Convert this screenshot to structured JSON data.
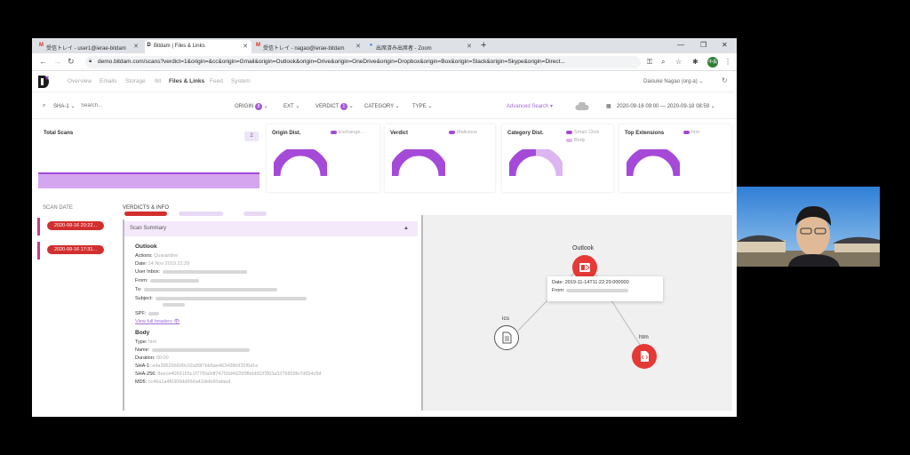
{
  "browser": {
    "tabs": [
      {
        "label": "受信トレイ - user1@ierae-bitdam",
        "icon": "gmail-icon"
      },
      {
        "label": "Bitdam | Files & Links",
        "icon": "bitdam-icon"
      },
      {
        "label": "受信トレイ - nagao@ierae-bitdam",
        "icon": "gmail-icon"
      },
      {
        "label": "出席済み出席者 - Zoom",
        "icon": "zoom-icon"
      }
    ],
    "url": "demo.bitdam.com/scans?verdict=1&origin=&cc&origin=Gmail&origin=Outlook&origin=Drive&origin=OneDrive&origin=Dropbox&origin=Box&origin=Slack&origin=Skype&origin=Direct...",
    "profile_initials": "中長"
  },
  "app": {
    "nav": [
      "Overview",
      "Emails",
      "Storage",
      "IM",
      "Files & Links",
      "Feed",
      "System"
    ],
    "active_nav": "Files & Links",
    "user": "Daisuke Nagao (org-a)"
  },
  "filters": {
    "hash_type": "SHA-1",
    "search_placeholder": "Search...",
    "origin": "ORIGIN",
    "origin_count": "8",
    "ext": "EXT",
    "verdict": "VERDICT",
    "verdict_count": "1",
    "category": "CATEGORY",
    "type": "TYPE",
    "advanced_search": "Advanced Search",
    "date_range": "2020-09-16 09:00 — 2020-09-18 08:59"
  },
  "cards": {
    "total_scans": {
      "title": "Total Scans",
      "count": "2"
    },
    "origin_dist": {
      "title": "Origin Dist.",
      "legend": [
        "Exchange..."
      ]
    },
    "verdict": {
      "title": "Verdict",
      "legend": [
        "Malicious"
      ]
    },
    "category_dist": {
      "title": "Category Dist.",
      "legend": [
        "Smart Click",
        "Body"
      ],
      "values": [
        0.5,
        0.5
      ]
    },
    "top_extensions": {
      "title": "Top Extensions",
      "legend": [
        "htm"
      ]
    }
  },
  "colors": {
    "accent": "#a54ad8",
    "light": "#dcb5f1",
    "malicious": "#e53935"
  },
  "scans": {
    "col_scan_date": "SCAN DATE",
    "col_verdicts": "VERDICTS & INFO",
    "rows": [
      "2020-09-16 20:22...",
      "2020-09-16 17:31..."
    ]
  },
  "summary": {
    "header": "Scan Summary",
    "outlook_title": "Outlook",
    "actions_label": "Actions:",
    "actions_value": "Quarantine",
    "date_label": "Date:",
    "date_value": "14 Nov 2019 22:29",
    "inbox_label": "User Inbox:",
    "from_label": "From:",
    "to_label": "To:",
    "subject_label": "Subject:",
    "spf_label": "SPF:",
    "view_headers": "View full headers",
    "body_title": "Body",
    "type_label": "Type:",
    "type_value": "htm",
    "name_label": "Name:",
    "duration_label": "Duration:",
    "duration_value": "00:00",
    "sha1_label": "SHA-1:",
    "sha1_value": "a4a396296699c02a99f7bb6ae463438b925f6d1e",
    "sha256_label": "SHA-256:",
    "sha256_value": "8eece4069165c1f77f0a9df74750d4925f3ffebb52f3f03a3376859fe7d654cfbf",
    "md5_label": "MD5:",
    "md5_value": "cc46a1a4f0309dd964a42defe60afaed"
  },
  "graph": {
    "outlook_label": "Outlook",
    "ics_label": "ics",
    "htm_label": "htm",
    "tooltip_date_label": "Date:",
    "tooltip_date_value": "2019-11-14T11:22:29.000000",
    "tooltip_from_label": "From:"
  }
}
